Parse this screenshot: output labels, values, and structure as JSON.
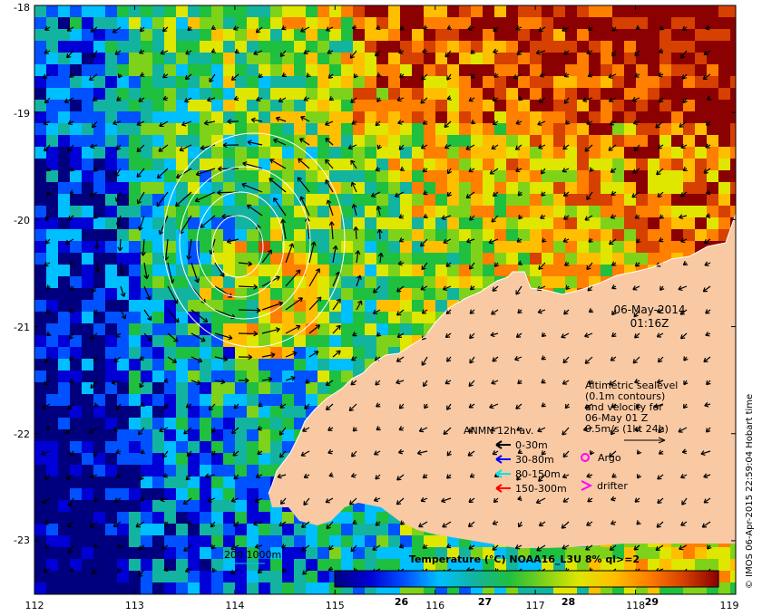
{
  "map": {
    "lon_ticks": [
      "112",
      "113",
      "114",
      "115",
      "116",
      "117",
      "118",
      "119"
    ],
    "lat_ticks": [
      "-18",
      "-19",
      "-20",
      "-21",
      "-22",
      "-23"
    ],
    "lon_range": [
      112,
      119
    ],
    "lat_range": [
      -18,
      -23.5
    ],
    "land_color": "#f9c9a3",
    "ocean_palette": [
      "#00007f",
      "#0000d6",
      "#0051ff",
      "#00bfff",
      "#12b4a0",
      "#1fbf3f",
      "#7fd21a",
      "#dfe600",
      "#ffbf00",
      "#ff7f00",
      "#d64000",
      "#8b0000"
    ]
  },
  "date_label": {
    "line1": "06-May-2014",
    "line2": "01:16Z"
  },
  "altimetry_note": {
    "line1": "Altimetric sealevel",
    "line2": "(0.1m contours)",
    "line3": "and velocity for",
    "line4": "06-May 01 Z",
    "line5": "0.5m/s (1kt 24h)"
  },
  "legend": {
    "title": "ANMN 12h av.",
    "items": [
      {
        "label": "0-30m",
        "color": "#000000"
      },
      {
        "label": "30-80m",
        "color": "#0000ff"
      },
      {
        "label": "80-150m",
        "color": "#00e5e5"
      },
      {
        "label": "150-300m",
        "color": "#ff0000"
      }
    ],
    "argo_label": "Argo",
    "argo_color": "#ff00ff",
    "drifter_label": "drifter",
    "drifter_color": "#ff00ff"
  },
  "depth_label": "200  1000m",
  "colorbar": {
    "title": "Temperature (°C) NOAA16_L3U 8% ql>=2",
    "ticks": [
      "26",
      "27",
      "28",
      "29"
    ],
    "range": [
      25.2,
      29.8
    ]
  },
  "credit": "© IMOS 06-Apr-2015 22:59:04 Hobart time"
}
